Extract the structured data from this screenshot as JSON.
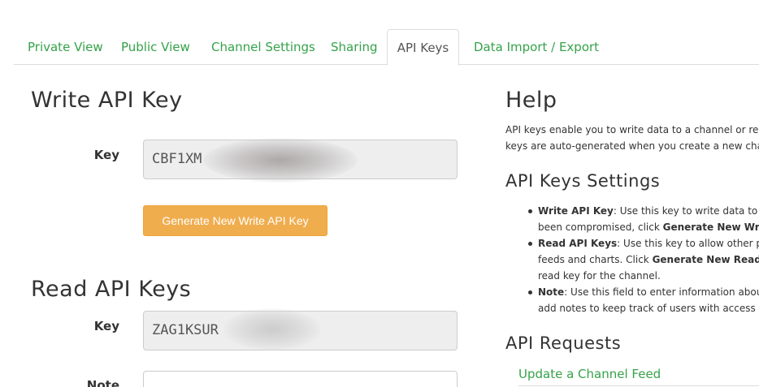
{
  "tabs": {
    "private_view": "Private View",
    "public_view": "Public View",
    "channel_settings": "Channel Settings",
    "sharing": "Sharing",
    "api_keys": "API Keys",
    "data_import_export": "Data Import / Export"
  },
  "write_section": {
    "title": "Write API Key",
    "key_label": "Key",
    "key_value": "CBF1XM",
    "generate_button": "Generate New Write API Key"
  },
  "read_section": {
    "title": "Read API Keys",
    "key_label": "Key",
    "key_value": "ZAG1KSUR",
    "note_label": "Note"
  },
  "help": {
    "title": "Help",
    "text_line1": "API keys enable you to write data to a channel or rea",
    "text_line2": "keys are auto-generated when you create a new chan",
    "settings_title": "API Keys Settings",
    "items": [
      {
        "term": "Write API Key",
        "line1": ": Use this key to write data to a c",
        "line2_prefix": "been compromised, click ",
        "line2_bold": "Generate New Write"
      },
      {
        "term": "Read API Keys",
        "line1": ": Use this key to allow other peo",
        "line2_prefix": "feeds and charts. Click ",
        "line2_bold": "Generate New Read AP",
        "line3": "read key for the channel."
      },
      {
        "term": "Note",
        "line1": ": Use this field to enter information abou",
        "line2_prefix": "add notes to keep track of users with access to"
      }
    ],
    "requests_title": "API Requests",
    "update_feed_link": "Update a Channel Feed"
  },
  "colors": {
    "accent_green": "#35a24a",
    "button_orange": "#f0ad4e"
  }
}
